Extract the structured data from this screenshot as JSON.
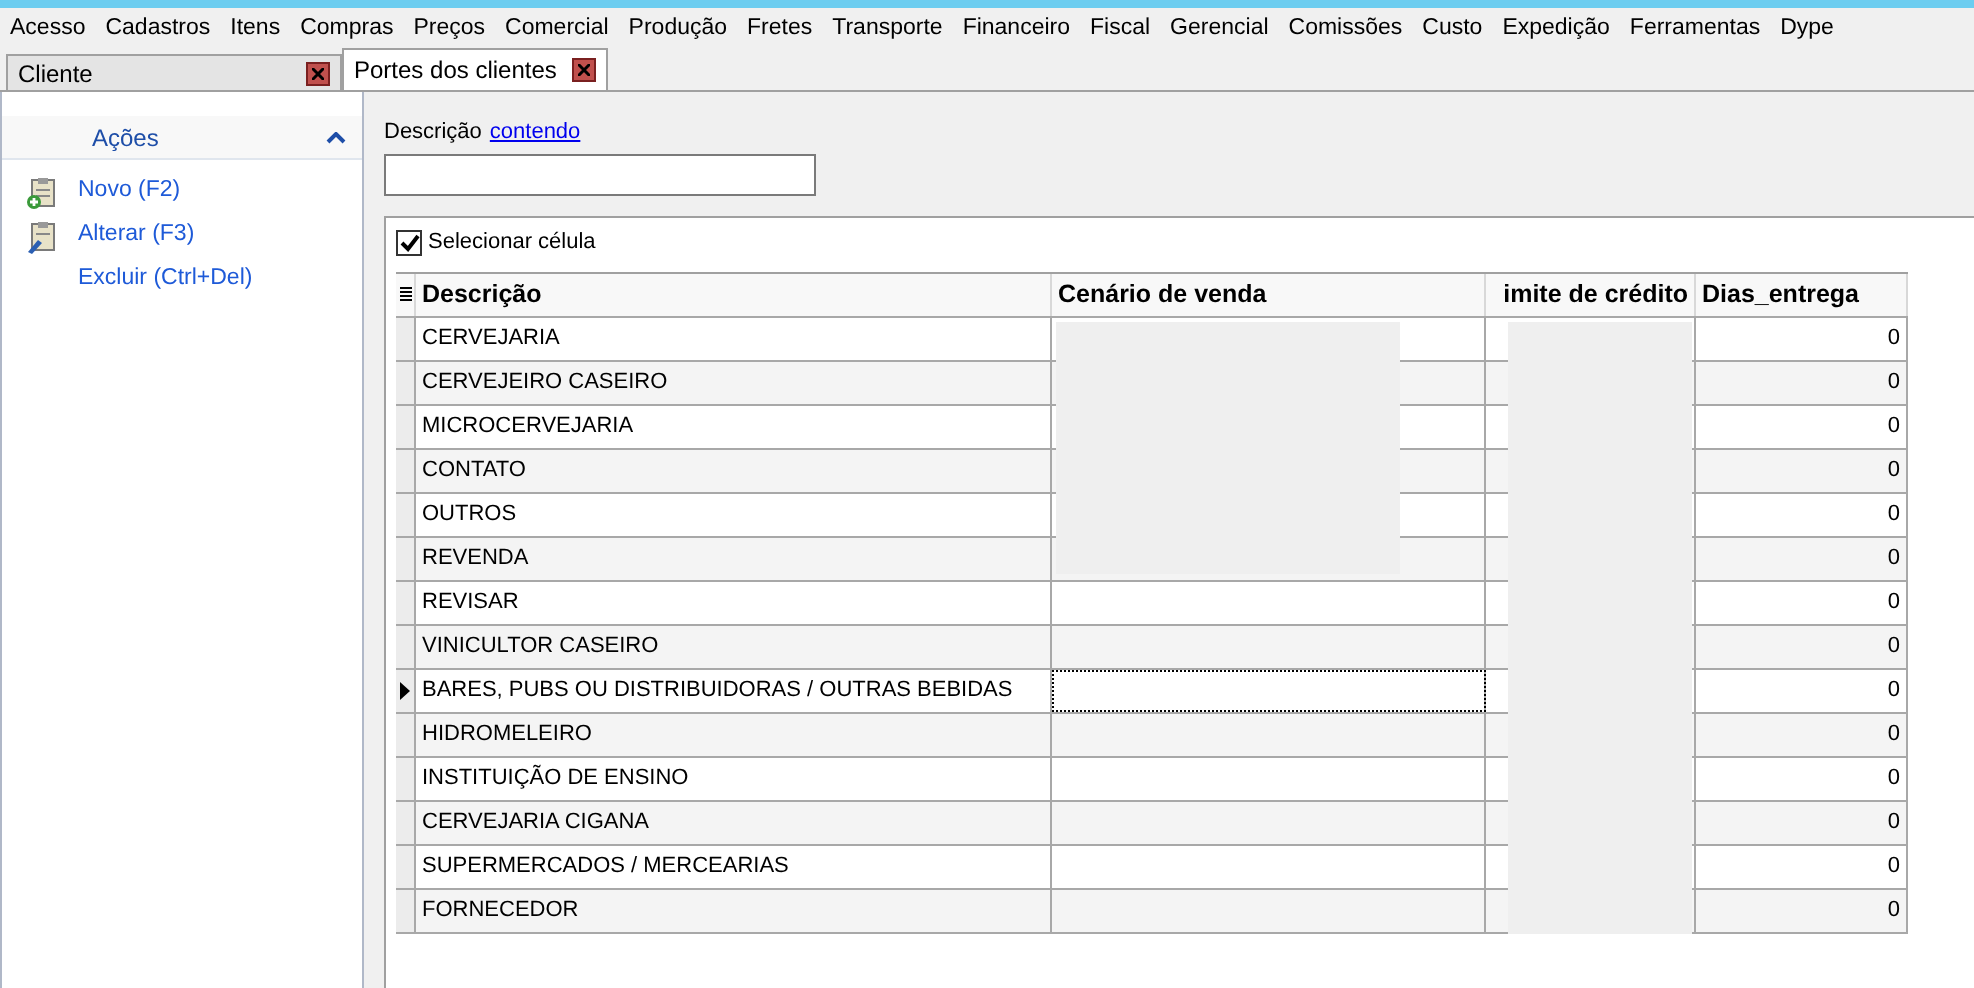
{
  "menu": [
    "Acesso",
    "Cadastros",
    "Itens",
    "Compras",
    "Preços",
    "Comercial",
    "Produção",
    "Fretes",
    "Transporte",
    "Financeiro",
    "Fiscal",
    "Gerencial",
    "Comissões",
    "Custo",
    "Expedição",
    "Ferramentas",
    "Dype"
  ],
  "tabs": [
    {
      "label": "Cliente",
      "selected": false
    },
    {
      "label": "Portes dos clientes",
      "selected": true
    }
  ],
  "sidebar": {
    "title": "Ações",
    "expanded": true,
    "items": [
      {
        "label": "Novo (F2)",
        "kind": "new"
      },
      {
        "label": "Alterar (F3)",
        "kind": "edit"
      },
      {
        "label": "Excluir (Ctrl+Del)",
        "kind": "plain"
      }
    ]
  },
  "filter": {
    "label": "Descrição",
    "link": "contendo"
  },
  "select_cell": {
    "label": "Selecionar célula",
    "checked": true
  },
  "table": {
    "columns": [
      "Descrição",
      "Cenário de venda",
      "imite de crédito",
      "Dias_entrega"
    ],
    "rows": [
      {
        "description": "CERVEJARIA",
        "dias": "0",
        "selected": false
      },
      {
        "description": "CERVEJEIRO CASEIRO",
        "dias": "0",
        "selected": false
      },
      {
        "description": "MICROCERVEJARIA",
        "dias": "0",
        "selected": false
      },
      {
        "description": "CONTATO",
        "dias": "0",
        "selected": false
      },
      {
        "description": "OUTROS",
        "dias": "0",
        "selected": false
      },
      {
        "description": "REVENDA",
        "dias": "0",
        "selected": false
      },
      {
        "description": "REVISAR",
        "dias": "0",
        "selected": false
      },
      {
        "description": "VINICULTOR CASEIRO",
        "dias": "0",
        "selected": false
      },
      {
        "description": "BARES, PUBS OU DISTRIBUIDORAS / OUTRAS BEBIDAS",
        "dias": "0",
        "selected": true
      },
      {
        "description": "HIDROMELEIRO",
        "dias": "0",
        "selected": false
      },
      {
        "description": "INSTITUIÇÃO DE ENSINO",
        "dias": "0",
        "selected": false
      },
      {
        "description": "CERVEJARIA CIGANA",
        "dias": "0",
        "selected": false
      },
      {
        "description": "SUPERMERCADOS / MERCEARIAS",
        "dias": "0",
        "selected": false
      },
      {
        "description": "FORNECEDOR",
        "dias": "0",
        "selected": false
      }
    ]
  }
}
